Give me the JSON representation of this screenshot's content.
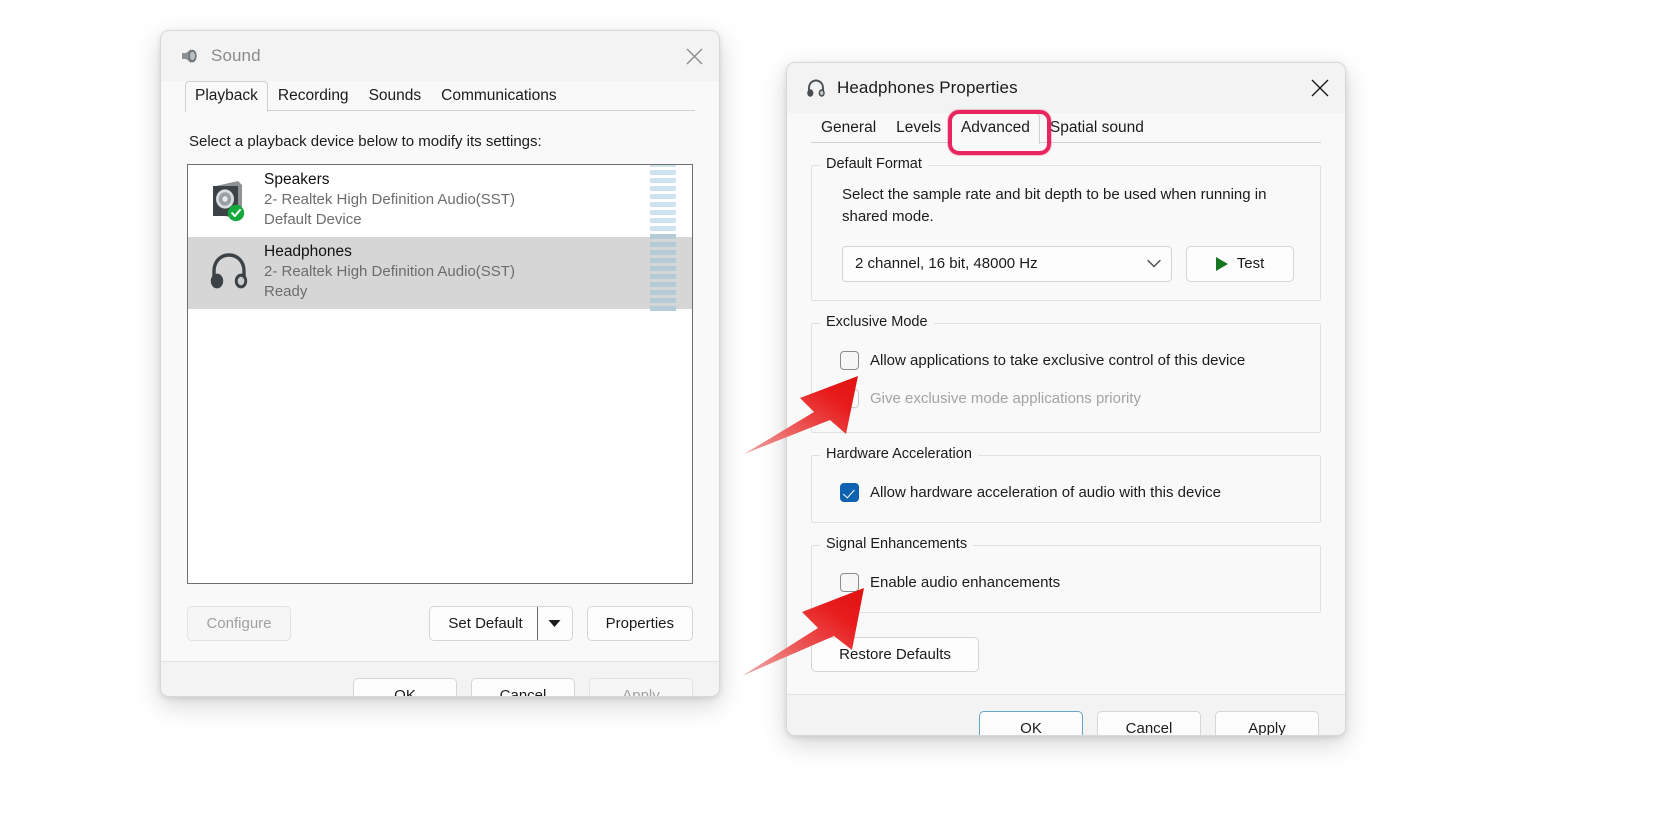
{
  "sound_dialog": {
    "title": "Sound",
    "title_icon": "speaker-icon",
    "close_label": "Close",
    "tabs": [
      {
        "label": "Playback",
        "selected": true
      },
      {
        "label": "Recording",
        "selected": false
      },
      {
        "label": "Sounds",
        "selected": false
      },
      {
        "label": "Communications",
        "selected": false
      }
    ],
    "hint": "Select a playback device below to modify its settings:",
    "devices": [
      {
        "name": "Speakers",
        "driver": "2- Realtek High Definition Audio(SST)",
        "status": "Default Device",
        "icon": "speaker-box-icon",
        "badge": "green-check-badge",
        "selected": false
      },
      {
        "name": "Headphones",
        "driver": "2- Realtek High Definition Audio(SST)",
        "status": "Ready",
        "icon": "headphones-icon",
        "badge": "",
        "selected": true
      }
    ],
    "buttons": {
      "configure": "Configure",
      "configure_disabled": true,
      "set_default": "Set Default",
      "set_default_dropdown_icon": "chevron-down-icon",
      "properties": "Properties"
    },
    "footer": {
      "ok": "OK",
      "cancel": "Cancel",
      "apply": "Apply",
      "apply_disabled": true
    }
  },
  "props_dialog": {
    "title": "Headphones Properties",
    "title_icon": "headphones-icon",
    "close_label": "Close",
    "tabs": [
      {
        "label": "General",
        "selected": false
      },
      {
        "label": "Levels",
        "selected": false
      },
      {
        "label": "Advanced",
        "selected": true,
        "highlighted": true
      },
      {
        "label": "Spatial sound",
        "selected": false
      }
    ],
    "default_format": {
      "group_label": "Default Format",
      "description": "Select the sample rate and bit depth to be used when running in shared mode.",
      "selected_option": "2 channel, 16 bit, 48000 Hz",
      "dropdown_icon": "chevron-down-icon",
      "test_label": "Test",
      "test_icon": "play-icon"
    },
    "exclusive_mode": {
      "group_label": "Exclusive Mode",
      "options": [
        {
          "label": "Allow applications to take exclusive control of this device",
          "checked": false,
          "disabled": false
        },
        {
          "label": "Give exclusive mode applications priority",
          "checked": false,
          "disabled": true
        }
      ]
    },
    "hardware_acceleration": {
      "group_label": "Hardware Acceleration",
      "options": [
        {
          "label": "Allow hardware acceleration of audio with this device",
          "checked": true,
          "disabled": false
        }
      ]
    },
    "signal_enhancements": {
      "group_label": "Signal Enhancements",
      "options": [
        {
          "label": "Enable audio enhancements",
          "checked": false,
          "disabled": false
        }
      ]
    },
    "restore_defaults": "Restore Defaults",
    "footer": {
      "ok": "OK",
      "cancel": "Cancel",
      "apply": "Apply"
    }
  },
  "annotations": {
    "highlight_color": "#e8255f",
    "arrow_color": "#e81c1c",
    "arrows": [
      {
        "name": "arrow-to-exclusive-control-checkbox"
      },
      {
        "name": "arrow-to-enable-audio-enhancements-checkbox"
      }
    ],
    "highlight_target": "Advanced"
  }
}
